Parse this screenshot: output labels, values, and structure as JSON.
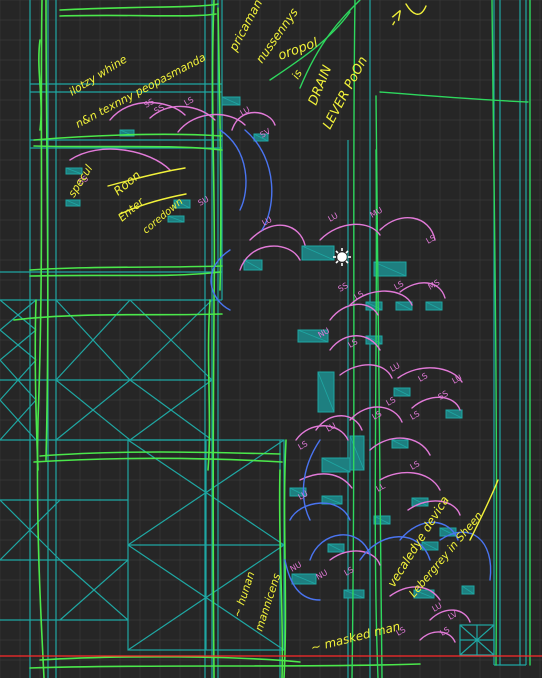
{
  "colors": {
    "background": "#262626",
    "grid": "#3a3a3a",
    "structure": "#1fa7a3",
    "structure_fill": "#1e7f80",
    "green_markup": "#4be84b",
    "lime_markup": "#2ed85e",
    "annotation": "#f2f23a",
    "pink_arc": "#e27ad8",
    "blue_arc": "#4a74f0",
    "baseline": "#ff2b2b",
    "cursor": "#ffffff"
  },
  "icons": {
    "cursor": "crosshair-sun-icon"
  },
  "annotations": {
    "n1": "ilotzy whine",
    "n2": "n&n texnny peopasmanda",
    "n3": "pricaman",
    "n4": "nussennys",
    "n5": "oropol",
    "n6": "is",
    "n7": "DRAIN",
    "n8": "LEVER PoOn",
    "n9": "specul",
    "n10": "Roon",
    "n11": "Enter",
    "n12": "coredown",
    "n13": "~ hunan",
    "n14": "mannicens",
    "n15": "vecaledye devica",
    "n16": "Lebergrey in Sheen",
    "n17": "~ masked man",
    "n18": "->"
  },
  "arc_labels": [
    "SS",
    "SS",
    "LS",
    "LU",
    "LU",
    "LU",
    "MU",
    "LS",
    "SS",
    "LS",
    "LS",
    "MS",
    "NU",
    "LS",
    "LU",
    "LS",
    "SS",
    "LS",
    "LU",
    "LS",
    "LS",
    "LS",
    "LL",
    "LU",
    "NU",
    "LS",
    "NU",
    "LS",
    "LU",
    "LU",
    "LS",
    "LS",
    "LV",
    "SU",
    "SS",
    "SV"
  ]
}
